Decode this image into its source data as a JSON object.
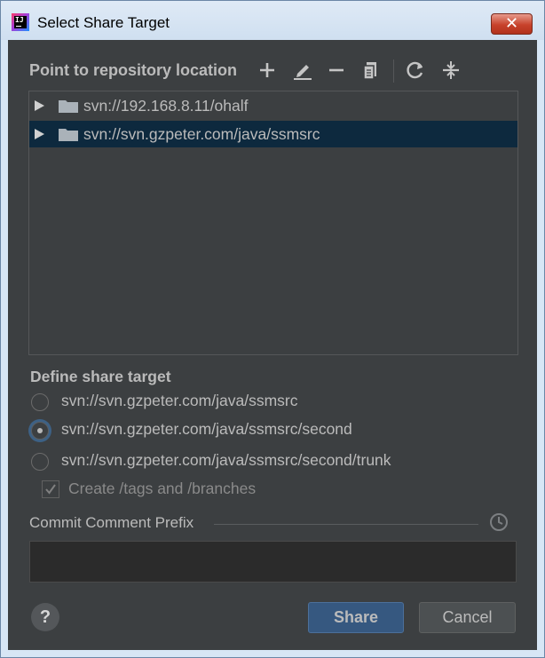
{
  "window": {
    "title": "Select Share Target",
    "close_glyph": "✕"
  },
  "toolbar": {
    "label": "Point to repository location",
    "icons": [
      "add-icon",
      "edit-icon",
      "remove-icon",
      "copy-icon",
      "refresh-icon",
      "collapse-icon"
    ]
  },
  "repositories": [
    {
      "url": "svn://192.168.8.11/ohalf",
      "selected": false
    },
    {
      "url": "svn://svn.gzpeter.com/java/ssmsrc",
      "selected": true
    }
  ],
  "share_target": {
    "title": "Define share target",
    "options": [
      {
        "label": "svn://svn.gzpeter.com/java/ssmsrc",
        "checked": false
      },
      {
        "label": "svn://svn.gzpeter.com/java/ssmsrc/second",
        "checked": true
      },
      {
        "label": "svn://svn.gzpeter.com/java/ssmsrc/second/trunk",
        "checked": false
      }
    ],
    "create_tags_label": "Create /tags and /branches",
    "create_tags_checked": true
  },
  "commit": {
    "prefix_label": "Commit Comment Prefix",
    "prefix_value": ""
  },
  "footer": {
    "help_glyph": "?",
    "share_label": "Share",
    "cancel_label": "Cancel"
  },
  "colors": {
    "panel_bg": "#3c3f41",
    "selection_bg": "#0d293e",
    "primary_button": "#365880",
    "close_button": "#c7422b"
  }
}
